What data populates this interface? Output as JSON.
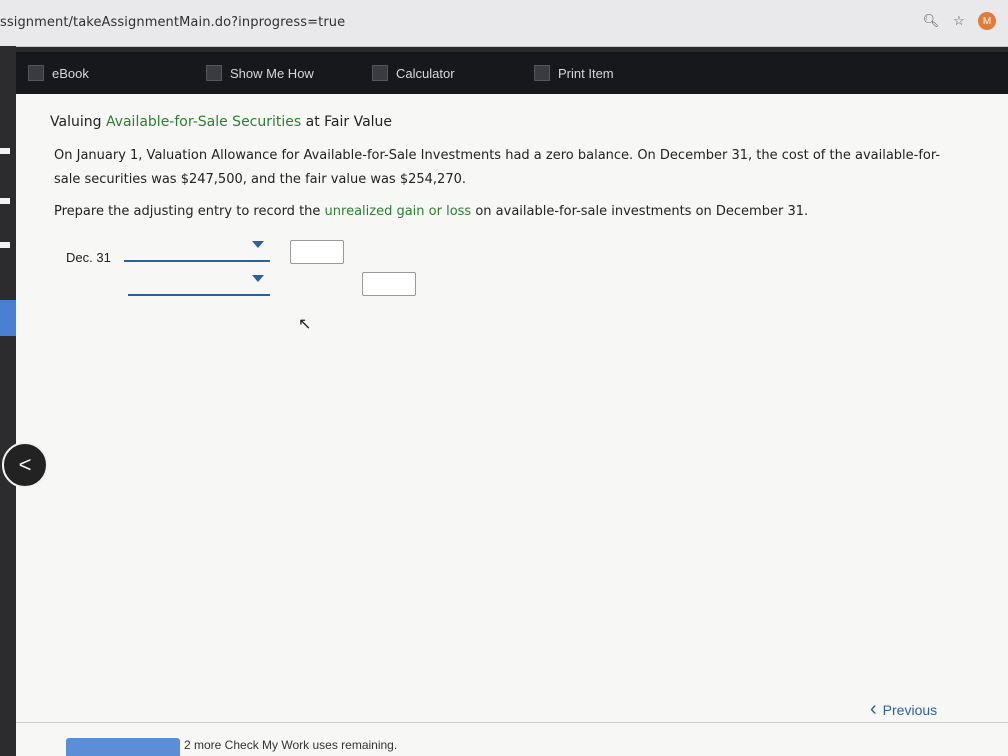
{
  "browser": {
    "url": "ssignment/takeAssignmentMain.do?inprogress=true",
    "avatar_letter": "M"
  },
  "toolbar": {
    "ebook": "eBook",
    "show_me_how": "Show Me How",
    "calculator": "Calculator",
    "print_item": "Print Item"
  },
  "problem": {
    "title_prefix": "Valuing ",
    "title_link": "Available-for-Sale Securities",
    "title_suffix": " at Fair Value",
    "paragraph_line1": "On January 1, Valuation Allowance for Available-for-Sale Investments had a zero balance. On December 31, the cost of the available-for-",
    "paragraph_line2": "sale securities was $247,500, and the fair value was $254,270.",
    "prompt_prefix": "Prepare the adjusting entry to record the ",
    "prompt_link": "unrealized gain or loss",
    "prompt_suffix": " on available-for-sale investments on December 31."
  },
  "journal": {
    "date_label": "Dec. 31"
  },
  "footer": {
    "previous": "Previous",
    "remaining": "2 more Check My Work uses remaining."
  },
  "nav": {
    "back_symbol": "<"
  }
}
